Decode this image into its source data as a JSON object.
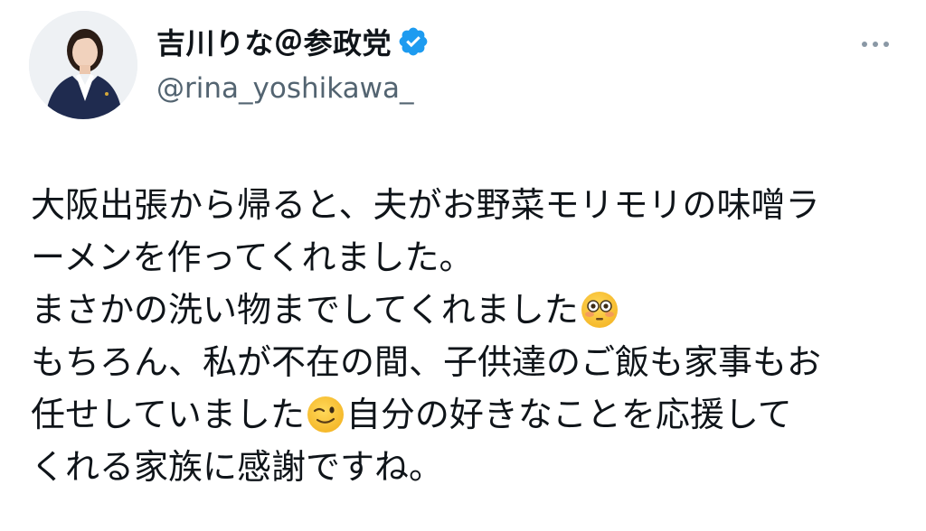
{
  "profile": {
    "display_name": "吉川りな＠参政党",
    "handle": "@rina_yoshikawa_",
    "avatar_icon": "profile-photo",
    "verified_icon": "verified-badge-icon",
    "verified_color": "#1d9bf0"
  },
  "actions": {
    "more_icon": "more-options-icon"
  },
  "tweet": {
    "line1": "大阪出張から帰ると、夫がお野菜モリモリの味噌ラ",
    "line2": "ーメンを作ってくれました。",
    "line3": "まさかの洗い物までしてくれました",
    "line3_emoji": "flushed-face-emoji",
    "line4": "もちろん、私が不在の間、子供達のご飯も家事もお",
    "line5a": "任せしていました",
    "line5_emoji": "winking-face-emoji",
    "line5b": "自分の好きなことを応援して",
    "line6": "くれる家族に感謝ですね。"
  },
  "colors": {
    "text": "#0f1419",
    "secondary_text": "#536471",
    "background": "#ffffff"
  }
}
